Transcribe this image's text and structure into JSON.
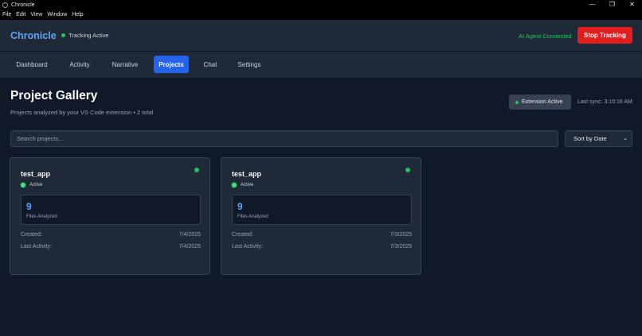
{
  "window": {
    "title": "Chronicle",
    "controls": {
      "minimize": "—",
      "maximize": "❐",
      "close": "✕"
    }
  },
  "menu": [
    "File",
    "Edit",
    "View",
    "Window",
    "Help"
  ],
  "header": {
    "brand": "Chronicle",
    "tracking_status": "Tracking Active",
    "ai_status": "AI Agent Connected",
    "stop_button": "Stop Tracking"
  },
  "nav": {
    "tabs": [
      {
        "label": "Dashboard",
        "active": false
      },
      {
        "label": "Activity",
        "active": false
      },
      {
        "label": "Narrative",
        "active": false
      },
      {
        "label": "Projects",
        "active": true
      },
      {
        "label": "Chat",
        "active": false
      },
      {
        "label": "Settings",
        "active": false
      }
    ]
  },
  "page": {
    "title": "Project Gallery",
    "subtitle": "Projects analyzed by your VS Code extension • 2 total",
    "extension_badge": "Extension Active",
    "last_sync": "Last sync: 3:10:16 AM"
  },
  "search": {
    "placeholder": "Search projects...",
    "value": ""
  },
  "sort": {
    "selected": "Sort by Date",
    "chevron": "⌄"
  },
  "projects": [
    {
      "name": "test_app",
      "status": "Active",
      "files_analyzed": "9",
      "files_label": "Files Analyzed",
      "created_label": "Created:",
      "created": "7/4/2025",
      "last_activity_label": "Last Activity:",
      "last_activity": "7/4/2025"
    },
    {
      "name": "test_app",
      "status": "Active",
      "files_analyzed": "9",
      "files_label": "Files Analyzed",
      "created_label": "Created:",
      "created": "7/3/2025",
      "last_activity_label": "Last Activity:",
      "last_activity": "7/3/2025"
    }
  ],
  "colors": {
    "accent": "#2563eb",
    "brand": "#60a5fa",
    "success": "#22c55e",
    "danger": "#e11d1d",
    "background": "#111827",
    "surface": "#1f2937"
  }
}
